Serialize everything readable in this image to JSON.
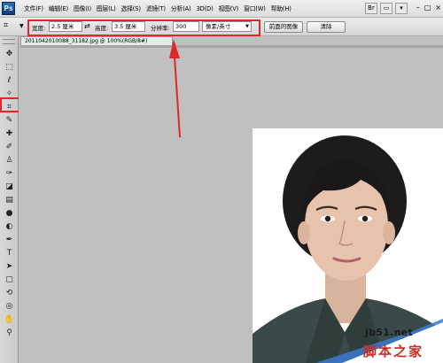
{
  "app": {
    "logo": "Ps"
  },
  "menu": [
    "文件(F)",
    "编辑(E)",
    "图像(I)",
    "图层(L)",
    "选择(S)",
    "滤镜(T)",
    "分析(A)",
    "3D(D)",
    "视图(V)",
    "窗口(W)",
    "帮助(H)"
  ],
  "menu_icons": [
    "Br",
    "▭",
    "▾"
  ],
  "window_buttons": {
    "minimize": "–",
    "restore": "□",
    "close": "×"
  },
  "options": {
    "tool_icon": "crop-icon",
    "width_label": "宽度:",
    "width_value": "2.5 厘米",
    "swap_icon": "⇄",
    "height_label": "高度:",
    "height_value": "3.5 厘米",
    "resolution_label": "分辨率:",
    "resolution_value": "300",
    "unit_value": "像素/英寸",
    "front_image_button": "前面的图像",
    "clear_button": "清除"
  },
  "document": {
    "tab_title": "2011042010088_31182.jpg @ 100%(RGB/8#)"
  },
  "colors": {
    "highlight": "#e0282b",
    "canvas_bg": "#c0c0c0",
    "watermark_red": "#cc2b22"
  },
  "watermark": {
    "url": "jb51.net",
    "name": "脚本之家"
  }
}
